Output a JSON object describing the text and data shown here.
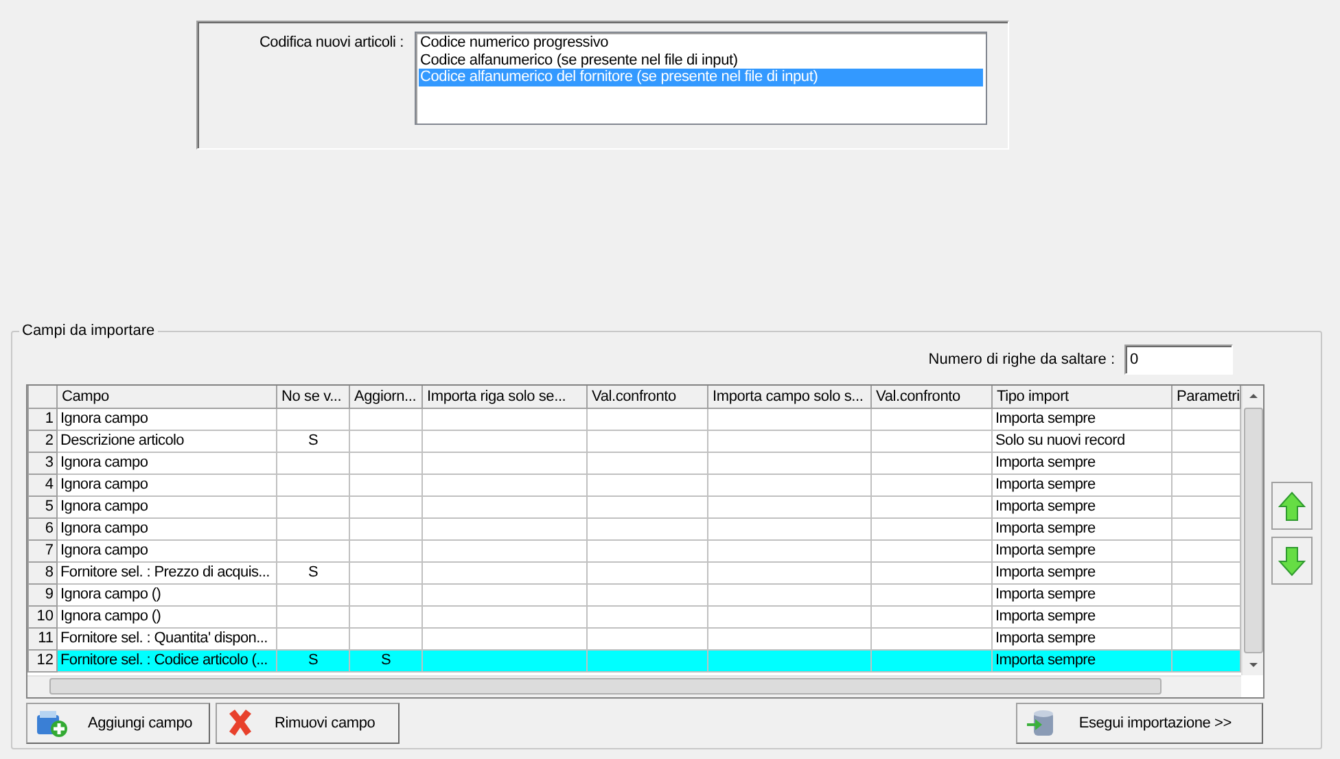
{
  "encoding": {
    "label": "Codifica nuovi articoli :",
    "options": [
      {
        "label": "Codice numerico progressivo",
        "selected": false
      },
      {
        "label": "Codice alfanumerico (se presente nel file di input)",
        "selected": false
      },
      {
        "label": "Codice alfanumerico del fornitore (se presente nel file di input)",
        "selected": true
      }
    ]
  },
  "fields_group": {
    "title": "Campi da importare",
    "skip_rows": {
      "label": "Numero di righe da saltare  :",
      "value": "0"
    },
    "table": {
      "columns": [
        "Campo",
        "No se v...",
        "Aggiorn...",
        "Importa riga solo se...",
        "Val.confronto",
        "Importa campo solo s...",
        "Val.confronto",
        "Tipo import",
        "Parametri"
      ],
      "rows": [
        {
          "num": "1",
          "cells": [
            "Ignora campo",
            "",
            "",
            "",
            "",
            "",
            "",
            "Importa sempre",
            ""
          ],
          "selected": false
        },
        {
          "num": "2",
          "cells": [
            "Descrizione articolo",
            "S",
            "",
            "",
            "",
            "",
            "",
            "Solo su nuovi record",
            ""
          ],
          "selected": false
        },
        {
          "num": "3",
          "cells": [
            "Ignora campo",
            "",
            "",
            "",
            "",
            "",
            "",
            "Importa sempre",
            ""
          ],
          "selected": false
        },
        {
          "num": "4",
          "cells": [
            "Ignora campo",
            "",
            "",
            "",
            "",
            "",
            "",
            "Importa sempre",
            ""
          ],
          "selected": false
        },
        {
          "num": "5",
          "cells": [
            "Ignora campo",
            "",
            "",
            "",
            "",
            "",
            "",
            "Importa sempre",
            ""
          ],
          "selected": false
        },
        {
          "num": "6",
          "cells": [
            "Ignora campo",
            "",
            "",
            "",
            "",
            "",
            "",
            "Importa sempre",
            ""
          ],
          "selected": false
        },
        {
          "num": "7",
          "cells": [
            "Ignora campo",
            "",
            "",
            "",
            "",
            "",
            "",
            "Importa sempre",
            ""
          ],
          "selected": false
        },
        {
          "num": "8",
          "cells": [
            "Fornitore sel. : Prezzo di acquis...",
            "S",
            "",
            "",
            "",
            "",
            "",
            "Importa sempre",
            ""
          ],
          "selected": false
        },
        {
          "num": "9",
          "cells": [
            "Ignora campo ()",
            "",
            "",
            "",
            "",
            "",
            "",
            "Importa sempre",
            ""
          ],
          "selected": false
        },
        {
          "num": "10",
          "cells": [
            "Ignora campo ()",
            "",
            "",
            "",
            "",
            "",
            "",
            "Importa sempre",
            ""
          ],
          "selected": false
        },
        {
          "num": "11",
          "cells": [
            "Fornitore sel. : Quantita' dispon...",
            "",
            "",
            "",
            "",
            "",
            "",
            "Importa sempre",
            ""
          ],
          "selected": false
        },
        {
          "num": "12",
          "cells": [
            "Fornitore sel. : Codice articolo (...",
            "S",
            "S",
            "",
            "",
            "",
            "",
            "Importa sempre",
            ""
          ],
          "selected": true
        }
      ]
    },
    "buttons": [
      {
        "label": "Aggiungi campo",
        "kind": "add"
      },
      {
        "label": "Rimuovi campo",
        "kind": "remove"
      },
      {
        "label": "Esegui importazione >>",
        "kind": "run"
      }
    ]
  }
}
